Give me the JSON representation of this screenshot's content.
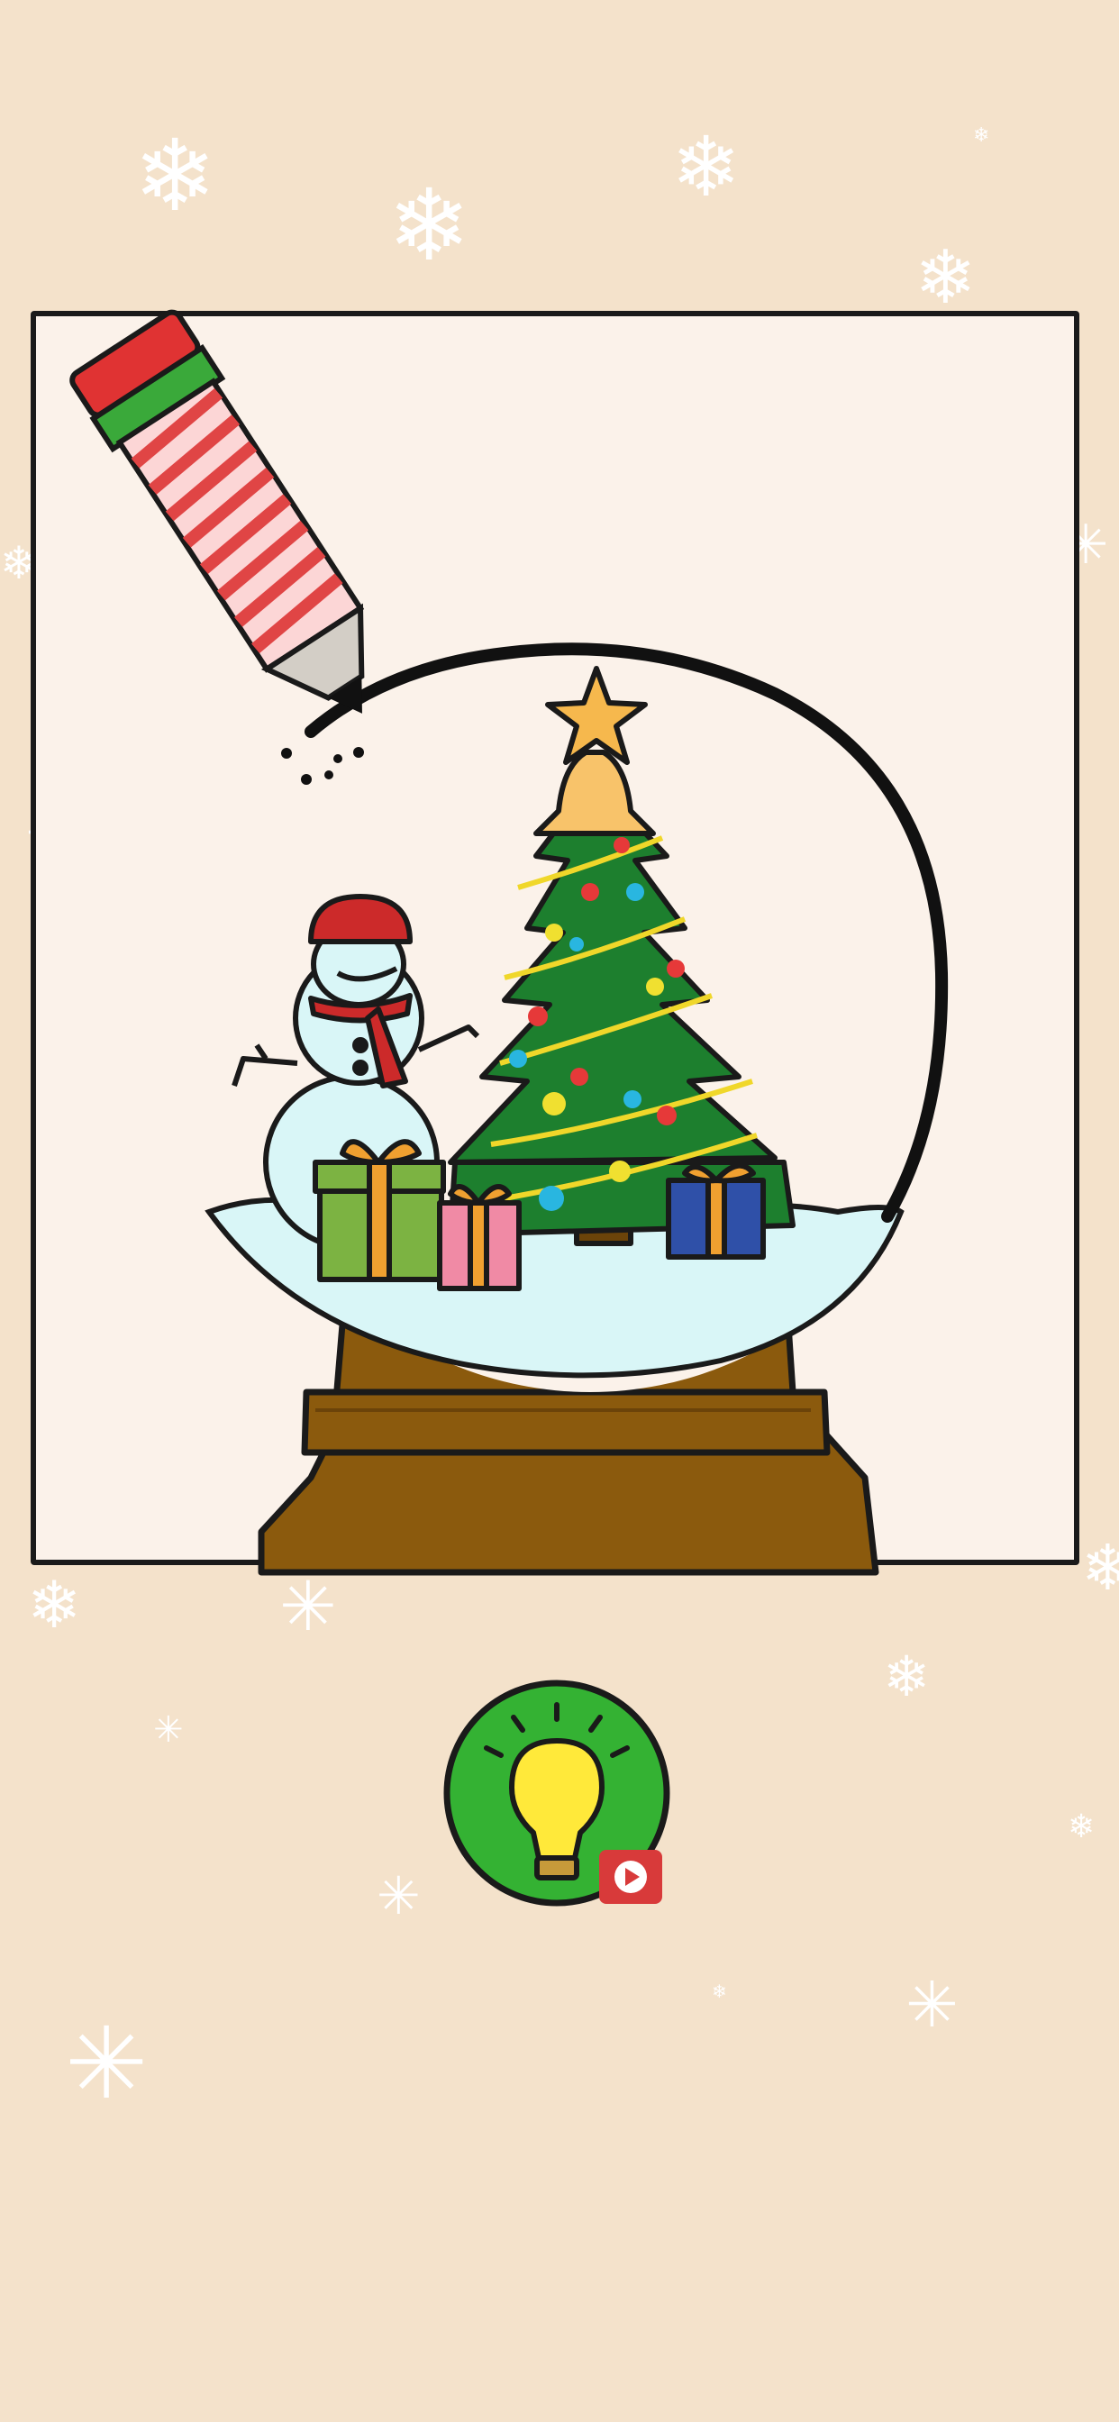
{
  "game": {
    "level_image": "snow globe with christmas tree, snowman and gifts",
    "tool": "candy-cane-pencil",
    "hint_icon": "lightbulb-icon",
    "ad_icon": "video-play-icon"
  },
  "colors": {
    "background": "#f4e2cb",
    "card": "#fbf2ea",
    "hint_green": "#34b233",
    "bulb_yellow": "#ffe93a",
    "video_red": "#d83a3a",
    "tree_green": "#1d7f2e",
    "base_brown": "#8b5a0d"
  }
}
